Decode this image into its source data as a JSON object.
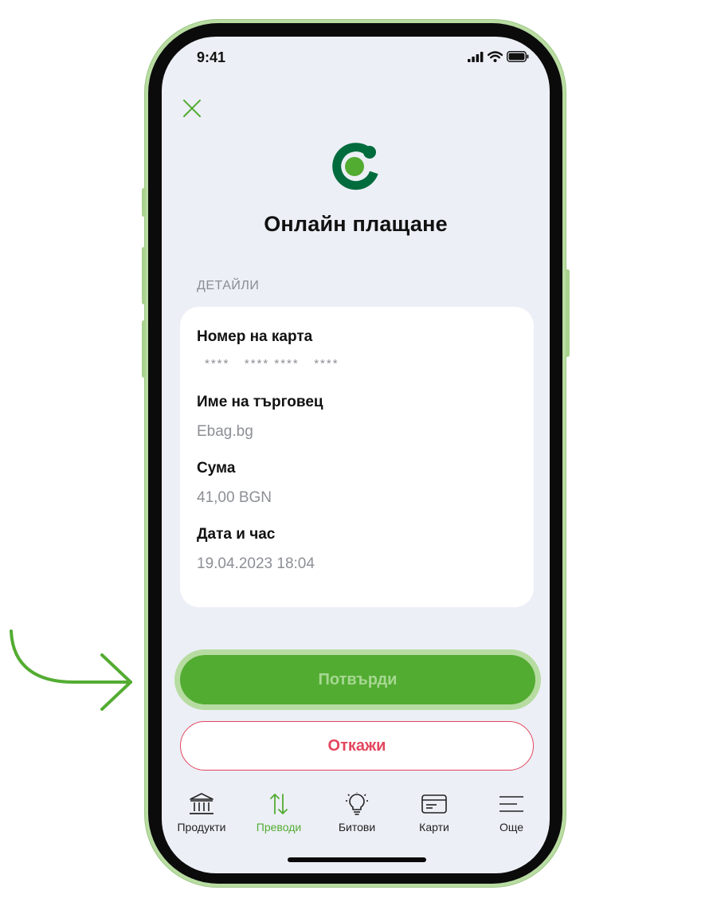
{
  "status_bar": {
    "time": "9:41"
  },
  "header": {
    "title": "Онлайн плащане"
  },
  "details": {
    "section_label": "ДЕТАЙЛИ",
    "fields": [
      {
        "label": "Номер на карта",
        "value": "****   **** ****   ****"
      },
      {
        "label": "Име на търговец",
        "value": "Ebag.bg"
      },
      {
        "label": "Сума",
        "value": "41,00 BGN"
      },
      {
        "label": "Дата и час",
        "value": "19.04.2023 18:04"
      }
    ]
  },
  "actions": {
    "confirm_label": "Потвърди",
    "cancel_label": "Откажи"
  },
  "tabbar": {
    "items": [
      {
        "label": "Продукти",
        "icon": "bank-icon"
      },
      {
        "label": "Преводи",
        "icon": "transfer-arrows-icon",
        "active": true
      },
      {
        "label": "Битови",
        "icon": "lightbulb-icon"
      },
      {
        "label": "Карти",
        "icon": "card-icon"
      },
      {
        "label": "Още",
        "icon": "menu-icon"
      }
    ]
  },
  "colors": {
    "brand_green": "#53ac32",
    "brand_dark_green": "#006b3c",
    "cancel_red": "#e4465e",
    "screen_bg": "#eceff6"
  }
}
